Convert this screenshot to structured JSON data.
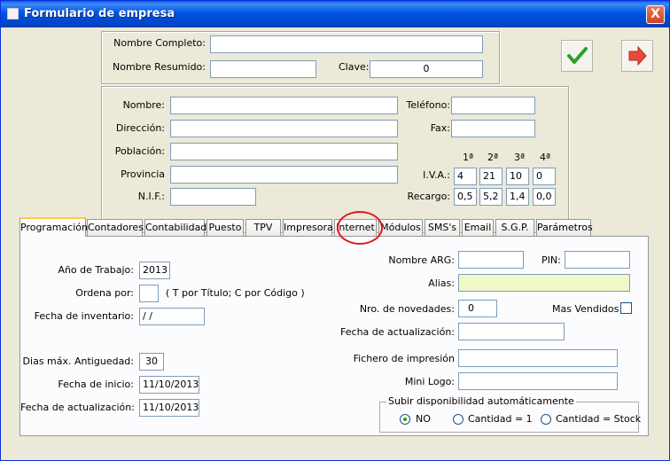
{
  "window": {
    "title": "Formulario de empresa",
    "close_glyph": "X"
  },
  "company": {
    "nombre_completo_label": "Nombre Completo:",
    "nombre_completo_value": "",
    "nombre_resumido_label": "Nombre Resumido:",
    "nombre_resumido_value": "",
    "clave_label": "Clave:",
    "clave_value": "0"
  },
  "contact": {
    "nombre_label": "Nombre:",
    "direccion_label": "Dirección:",
    "poblacion_label": "Población:",
    "provincia_label": "Provincia",
    "nif_label": "N.I.F.:",
    "telefono_label": "Teléfono:",
    "fax_label": "Fax:",
    "iva_label": "I.V.A.:",
    "recargo_label": "Recargo:",
    "rate_headers": [
      "1ª",
      "2ª",
      "3ª",
      "4ª"
    ],
    "iva_values": [
      "4",
      "21",
      "10",
      "0"
    ],
    "recargo_values": [
      "0,5",
      "5,2",
      "1,4",
      "0,0"
    ]
  },
  "tabs": [
    {
      "label": "Programación"
    },
    {
      "label": "Contadores"
    },
    {
      "label": "Contabilidad"
    },
    {
      "label": "Puesto"
    },
    {
      "label": "TPV"
    },
    {
      "label": "Impresora"
    },
    {
      "label": "Internet"
    },
    {
      "label": "Módulos"
    },
    {
      "label": "SMS's"
    },
    {
      "label": "Email"
    },
    {
      "label": "S.G.P."
    },
    {
      "label": "Parámetros"
    }
  ],
  "programacion": {
    "ano_trabajo_label": "Año de Trabajo:",
    "ano_trabajo_value": "2013",
    "ordena_por_label": "Ordena por:",
    "ordena_por_value": "",
    "ordena_por_hint": "( T por Título; C por Código )",
    "fecha_inventario_label": "Fecha de inventario:",
    "fecha_inventario_value": " /  /",
    "dias_antiguedad_label": "Dias máx. Antiguedad:",
    "dias_antiguedad_value": "30",
    "fecha_inicio_label": "Fecha de inicio:",
    "fecha_inicio_value": "11/10/2013",
    "fecha_actualizacion_label": "Fecha de actualización:",
    "fecha_actualizacion_value": "11/10/2013",
    "nombre_arg_label": "Nombre ARG:",
    "pin_label": "PIN:",
    "alias_label": "Alias:",
    "nro_novedades_label": "Nro. de novedades:",
    "nro_novedades_value": "0",
    "mas_vendidos_label": "Mas Vendidos",
    "fecha_actualizacion2_label": "Fecha de actualización:",
    "fichero_impresion_label": "Fichero de impresión",
    "mini_logo_label": "Mini Logo:",
    "subir_group_label": "Subir disponibilidad automáticamente",
    "radio_options": [
      "NO",
      "Cantidad = 1",
      "Cantidad = Stock"
    ],
    "radio_selected": "NO"
  },
  "colors": {
    "titlebar": "#0054e3",
    "accept_check": "#2aa02a",
    "exit_arrow": "#e84a3c",
    "highlight_circle": "#e0161c",
    "alias_field": "#f2f7c7"
  }
}
